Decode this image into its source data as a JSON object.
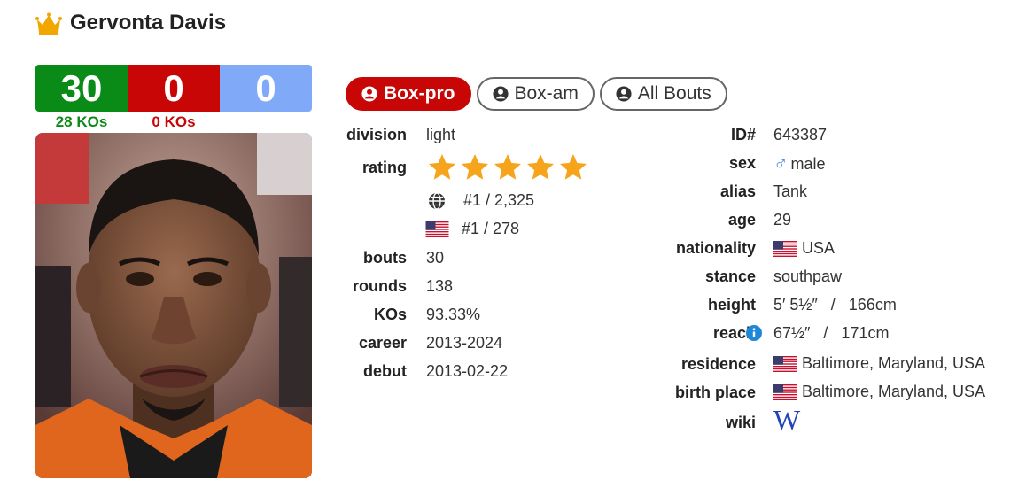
{
  "fighter": {
    "name": "Gervonta Davis"
  },
  "record": {
    "wins": "30",
    "losses": "0",
    "draws": "0",
    "win_kos": "28 KOs",
    "loss_kos": "0 KOs"
  },
  "tabs": [
    {
      "label": "Box-pro",
      "active": true
    },
    {
      "label": "Box-am",
      "active": false
    },
    {
      "label": "All Bouts",
      "active": false
    }
  ],
  "details_left": {
    "division": {
      "label": "division",
      "value": "light"
    },
    "rating": {
      "label": "rating",
      "stars": 5,
      "world_rank": "#1 / 2,325",
      "country_rank": "#1 / 278"
    },
    "bouts": {
      "label": "bouts",
      "value": "30"
    },
    "rounds": {
      "label": "rounds",
      "value": "138"
    },
    "kos": {
      "label": "KOs",
      "value": "93.33%"
    },
    "career": {
      "label": "career",
      "value": "2013-2024"
    },
    "debut": {
      "label": "debut",
      "value": "2013-02-22"
    }
  },
  "details_right": {
    "id": {
      "label": "ID#",
      "value": "643387"
    },
    "sex": {
      "label": "sex",
      "symbol": "♂",
      "value": "male"
    },
    "alias": {
      "label": "alias",
      "value": "Tank"
    },
    "age": {
      "label": "age",
      "value": "29"
    },
    "nationality": {
      "label": "nationality",
      "value": "USA"
    },
    "stance": {
      "label": "stance",
      "value": "southpaw"
    },
    "height": {
      "label": "height",
      "value": "5′ 5½″   /   166cm"
    },
    "reach": {
      "label": "reach",
      "value": "67½″   /   171cm"
    },
    "residence": {
      "label": "residence",
      "value": "Baltimore, Maryland, USA"
    },
    "birth_place": {
      "label": "birth place",
      "value": "Baltimore, Maryland, USA"
    },
    "wiki": {
      "label": "wiki",
      "value": "W"
    }
  },
  "colors": {
    "win": "#0a8a16",
    "loss": "#c80606",
    "draw": "#80aaf7",
    "star": "#f7a41d",
    "crown": "#f2a600"
  },
  "icons": [
    "crown-icon",
    "user-circle-icon",
    "star-icon",
    "globe-icon",
    "us-flag-icon",
    "male-icon",
    "info-icon",
    "wikipedia-icon"
  ]
}
